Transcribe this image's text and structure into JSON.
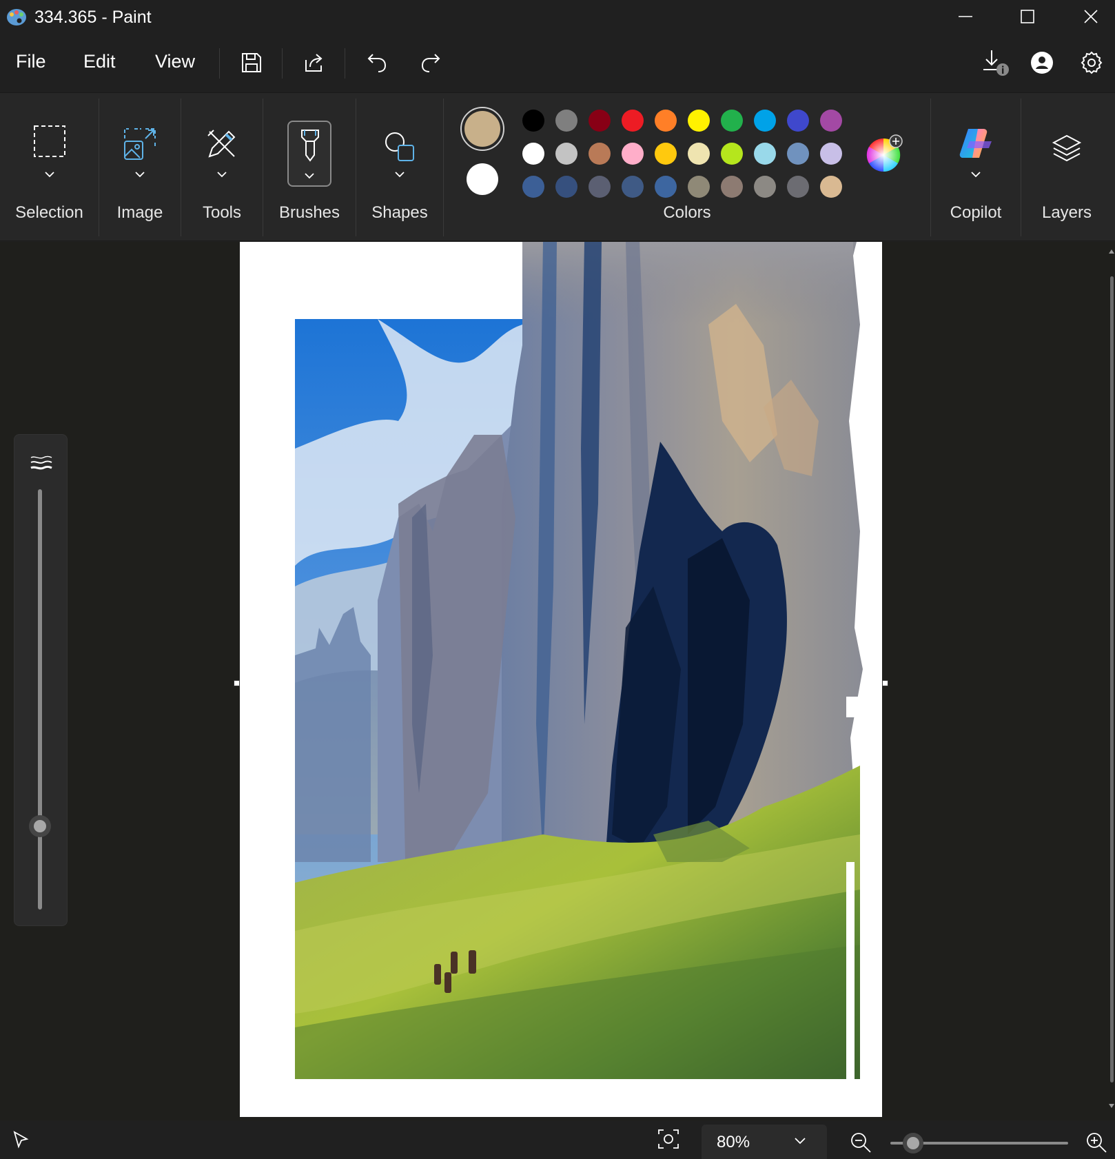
{
  "window": {
    "title": "334.365 - Paint"
  },
  "menu": {
    "file": "File",
    "edit": "Edit",
    "view": "View"
  },
  "ribbon": {
    "selection_label": "Selection",
    "image_label": "Image",
    "tools_label": "Tools",
    "brushes_label": "Brushes",
    "shapes_label": "Shapes",
    "colors_label": "Colors",
    "copilot_label": "Copilot",
    "layers_label": "Layers"
  },
  "colors": {
    "primary": "#c8b08a",
    "secondary": "#ffffff",
    "palette": [
      [
        "#000000",
        "#7f7f7f",
        "#880015",
        "#ed1c24",
        "#ff7f27",
        "#fff200",
        "#22b14c",
        "#00a2e8",
        "#3f48cc",
        "#a349a4"
      ],
      [
        "#ffffff",
        "#c3c3c3",
        "#b97a57",
        "#ffaec9",
        "#ffc90e",
        "#efe4b0",
        "#b5e61d",
        "#99d9ea",
        "#7092be",
        "#c8bfe7"
      ],
      [
        "#3c5f96",
        "#36507e",
        "#5b5f72",
        "#3f5a85",
        "#3d66a0",
        "#8f8977",
        "#8d7b72",
        "#8c8984",
        "#6c6c72",
        "#d9b992"
      ]
    ]
  },
  "status": {
    "zoom": "80%",
    "zoom_fraction": 0.12
  },
  "icons": {
    "app": "paint-palette-icon",
    "minimize": "minimize-icon",
    "maximize": "maximize-icon",
    "close": "close-icon",
    "save": "save-icon",
    "share": "share-icon",
    "undo": "undo-icon",
    "redo": "redo-icon",
    "download": "download-info-icon",
    "account": "account-icon",
    "settings": "gear-icon"
  }
}
